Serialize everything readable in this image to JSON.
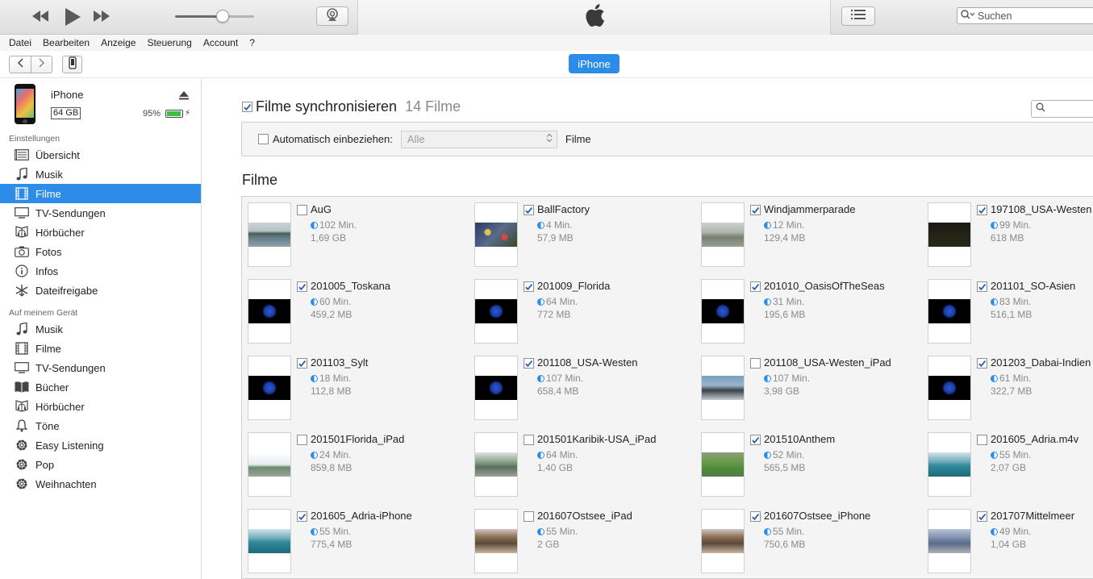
{
  "search": {
    "placeholder": "Suchen"
  },
  "menu": [
    "Datei",
    "Bearbeiten",
    "Anzeige",
    "Steuerung",
    "Account",
    "?"
  ],
  "player": {
    "volume_level": 0.6
  },
  "nav": {
    "device_pill": "iPhone"
  },
  "device": {
    "name": "iPhone",
    "capacity": "64 GB",
    "battery_text": "95%",
    "battery_level": 0.95
  },
  "sidebar": {
    "settings_label": "Einstellungen",
    "settings_items": [
      {
        "label": "Übersicht",
        "icon": "summary-icon"
      },
      {
        "label": "Musik",
        "icon": "music-note-icon"
      },
      {
        "label": "Filme",
        "icon": "film-icon",
        "active": true
      },
      {
        "label": "TV-Sendungen",
        "icon": "tv-icon"
      },
      {
        "label": "Hörbücher",
        "icon": "audiobook-icon"
      },
      {
        "label": "Fotos",
        "icon": "camera-icon"
      },
      {
        "label": "Infos",
        "icon": "info-icon"
      },
      {
        "label": "Dateifreigabe",
        "icon": "file-sharing-icon"
      }
    ],
    "device_label": "Auf meinem Gerät",
    "device_items": [
      {
        "label": "Musik",
        "icon": "music-note-icon"
      },
      {
        "label": "Filme",
        "icon": "film-icon"
      },
      {
        "label": "TV-Sendungen",
        "icon": "tv-icon"
      },
      {
        "label": "Bücher",
        "icon": "book-icon"
      },
      {
        "label": "Hörbücher",
        "icon": "audiobook-icon"
      },
      {
        "label": "Töne",
        "icon": "bell-icon"
      },
      {
        "label": "Easy Listening",
        "icon": "gear-icon"
      },
      {
        "label": "Pop",
        "icon": "gear-icon"
      },
      {
        "label": "Weihnachten",
        "icon": "gear-icon"
      }
    ]
  },
  "main": {
    "sync_title": "Filme synchronisieren",
    "sync_count": "14 Filme",
    "sync_checked": true,
    "auto_label": "Automatisch einbeziehen:",
    "auto_checked": false,
    "auto_select_value": "Alle",
    "auto_suffix": "Filme",
    "section_title": "Filme",
    "movies": [
      {
        "name": "AuG",
        "duration": "102 Min.",
        "size": "1,69 GB",
        "checked": false,
        "thumb": "water-landscape"
      },
      {
        "name": "BallFactory",
        "duration": "4 Min.",
        "size": "57,9 MB",
        "checked": true,
        "thumb": "colorful-crowd"
      },
      {
        "name": "Windjammerparade",
        "duration": "12 Min.",
        "size": "129,4 MB",
        "checked": true,
        "thumb": "grey-hall"
      },
      {
        "name": "197108_USA-Westen",
        "duration": "99 Min.",
        "size": "618 MB",
        "checked": true,
        "thumb": "dark-title"
      },
      {
        "name": "201005_Toskana",
        "duration": "60 Min.",
        "size": "459,2 MB",
        "checked": true,
        "thumb": "globe"
      },
      {
        "name": "201009_Florida",
        "duration": "64 Min.",
        "size": "772 MB",
        "checked": true,
        "thumb": "globe"
      },
      {
        "name": "201010_OasisOfTheSeas",
        "duration": "31 Min.",
        "size": "195,6 MB",
        "checked": true,
        "thumb": "globe"
      },
      {
        "name": "201101_SO-Asien",
        "duration": "83 Min.",
        "size": "516,1 MB",
        "checked": true,
        "thumb": "globe"
      },
      {
        "name": "201103_Sylt",
        "duration": "18 Min.",
        "size": "112,8 MB",
        "checked": true,
        "thumb": "globe"
      },
      {
        "name": "201108_USA-Westen",
        "duration": "107 Min.",
        "size": "658,4 MB",
        "checked": true,
        "thumb": "globe"
      },
      {
        "name": "201108_USA-Westen_iPad",
        "duration": "107 Min.",
        "size": "3,98 GB",
        "checked": false,
        "thumb": "street-car"
      },
      {
        "name": "201203_Dabai-Indien",
        "duration": "61 Min.",
        "size": "322,7 MB",
        "checked": true,
        "thumb": "globe"
      },
      {
        "name": "201501Florida_iPad",
        "duration": "24 Min.",
        "size": "859,8 MB",
        "checked": false,
        "thumb": "bridge-sky"
      },
      {
        "name": "201501Karibik-USA_iPad",
        "duration": "64 Min.",
        "size": "1,40 GB",
        "checked": false,
        "thumb": "street-green"
      },
      {
        "name": "201510Anthem",
        "duration": "52 Min.",
        "size": "565,5 MB",
        "checked": true,
        "thumb": "green-field"
      },
      {
        "name": "201605_Adria.m4v",
        "duration": "55 Min.",
        "size": "2,07 GB",
        "checked": false,
        "thumb": "sea"
      },
      {
        "name": "201605_Adria-iPhone",
        "duration": "55 Min.",
        "size": "775,4 MB",
        "checked": true,
        "thumb": "sea"
      },
      {
        "name": "201607Ostsee_iPad",
        "duration": "55 Min.",
        "size": "2 GB",
        "checked": false,
        "thumb": "town"
      },
      {
        "name": "201607Ostsee_iPhone",
        "duration": "55 Min.",
        "size": "750,6 MB",
        "checked": true,
        "thumb": "town"
      },
      {
        "name": "201707Mittelmeer",
        "duration": "49 Min.",
        "size": "1,04 GB",
        "checked": true,
        "thumb": "harbor"
      }
    ]
  }
}
